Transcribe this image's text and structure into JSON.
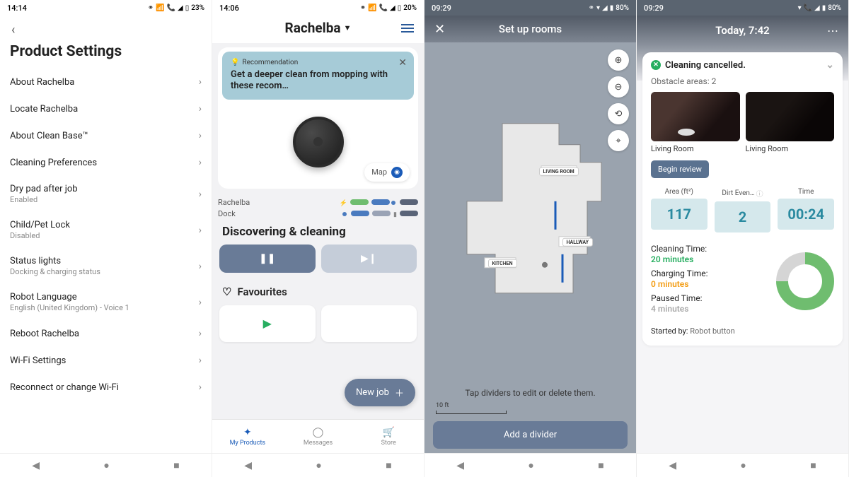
{
  "screen1": {
    "status": {
      "time": "14:14",
      "battery": "23%"
    },
    "title": "Product Settings",
    "items": [
      {
        "label": "About Rachelba",
        "sub": ""
      },
      {
        "label": "Locate Rachelba",
        "sub": ""
      },
      {
        "label": "About Clean Base™",
        "sub": ""
      },
      {
        "label": "Cleaning Preferences",
        "sub": ""
      },
      {
        "label": "Dry pad after job",
        "sub": "Enabled"
      },
      {
        "label": "Child/Pet Lock",
        "sub": "Disabled"
      },
      {
        "label": "Status lights",
        "sub": "Docking & charging status"
      },
      {
        "label": "Robot Language",
        "sub": "English (United Kingdom) - Voice 1"
      },
      {
        "label": "Reboot Rachelba",
        "sub": ""
      },
      {
        "label": "Wi-Fi Settings",
        "sub": ""
      },
      {
        "label": "Reconnect or change Wi-Fi",
        "sub": ""
      }
    ]
  },
  "screen2": {
    "status": {
      "time": "14:06",
      "battery": "20%"
    },
    "robot_name": "Rachelba",
    "reco_tag": "Recommendation",
    "reco_text": "Get a deeper clean from mopping with these recom…",
    "map_label": "Map",
    "line_robot": "Rachelba",
    "line_dock": "Dock",
    "state": "Discovering & cleaning",
    "favourites": "Favourites",
    "newjob": "New job",
    "nav": {
      "products": "My Products",
      "messages": "Messages",
      "store": "Store"
    }
  },
  "screen3": {
    "status": {
      "time": "09:29",
      "battery": "80%"
    },
    "title": "Set up rooms",
    "rooms": {
      "living": "LIVING ROOM",
      "hallway": "HALLWAY",
      "kitchen": "KITCHEN"
    },
    "hint": "Tap dividers to edit or delete them.",
    "scale": "10 ft",
    "button": "Add a divider"
  },
  "screen4": {
    "status": {
      "time": "09:29",
      "battery": "80%"
    },
    "title": "Today, 7:42",
    "status_text": "Cleaning cancelled.",
    "obstacle": "Obstacle areas: 2",
    "thumb1": "Living Room",
    "thumb2": "Living Room",
    "review": "Begin review",
    "stat_labels": {
      "area": "Area (ft²)",
      "dirt": "Dirt Even…",
      "time": "Time"
    },
    "stat_values": {
      "area": "117",
      "dirt": "2",
      "time": "00:24"
    },
    "times": {
      "clean_l": "Cleaning Time:",
      "clean_v": "20 minutes",
      "charge_l": "Charging Time:",
      "charge_v": "0 minutes",
      "pause_l": "Paused Time:",
      "pause_v": "4 minutes"
    },
    "started_l": "Started by:",
    "started_v": "Robot button"
  }
}
